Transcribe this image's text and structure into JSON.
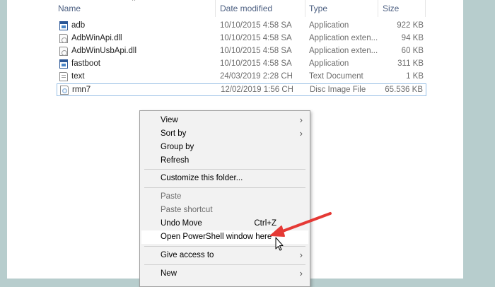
{
  "columns": {
    "name": "Name",
    "date": "Date modified",
    "type": "Type",
    "size": "Size"
  },
  "files": [
    {
      "icon": "application-icon",
      "name": "adb",
      "date": "10/10/2015 4:58 SA",
      "type": "Application",
      "size": "922 KB"
    },
    {
      "icon": "dll-file-icon",
      "name": "AdbWinApi.dll",
      "date": "10/10/2015 4:58 SA",
      "type": "Application exten...",
      "size": "94 KB"
    },
    {
      "icon": "dll-file-icon",
      "name": "AdbWinUsbApi.dll",
      "date": "10/10/2015 4:58 SA",
      "type": "Application exten...",
      "size": "60 KB"
    },
    {
      "icon": "application-icon",
      "name": "fastboot",
      "date": "10/10/2015 4:58 SA",
      "type": "Application",
      "size": "311 KB"
    },
    {
      "icon": "text-file-icon",
      "name": "text",
      "date": "24/03/2019 2:28 CH",
      "type": "Text Document",
      "size": "1 KB"
    },
    {
      "icon": "disc-image-icon",
      "name": "rmn7",
      "date": "12/02/2019 1:56 CH",
      "type": "Disc Image File",
      "size": "65.536 KB"
    }
  ],
  "menu": {
    "view": "View",
    "sort_by": "Sort by",
    "group_by": "Group by",
    "refresh": "Refresh",
    "customize": "Customize this folder...",
    "paste": "Paste",
    "paste_shortcut": "Paste shortcut",
    "undo_move": "Undo Move",
    "undo_shortcut": "Ctrl+Z",
    "open_powershell": "Open PowerShell window here",
    "give_access": "Give access to",
    "new": "New"
  },
  "colors": {
    "annotation_arrow": "#e53935",
    "background": "#b7cdcd"
  }
}
